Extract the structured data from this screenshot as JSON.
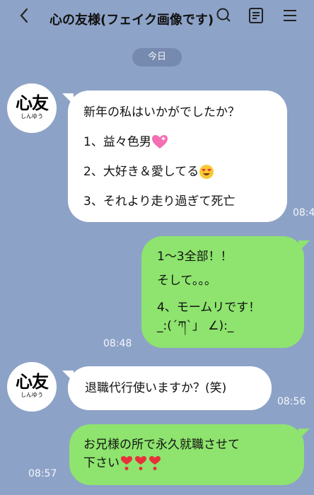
{
  "header": {
    "title": "心の友様(フェイク画像です)",
    "back_icon": "chevron-left-icon",
    "icons": [
      "search-icon",
      "notes-icon",
      "menu-icon"
    ]
  },
  "date_label": "今日",
  "contact": {
    "avatar_big": "心友",
    "avatar_small": "しんゆう"
  },
  "messages": [
    {
      "side": "in",
      "lines": [
        "新年の私はいかがでしたか？",
        "1、益々色男",
        "2、大好き＆愛してる",
        "3、それより走り過ぎて死亡"
      ],
      "time": "08:4"
    },
    {
      "side": "out",
      "lines": [
        "1〜3全部！！",
        "そして。。。",
        "4、モームリです！",
        "_:(´ཀ`」 ∠):_"
      ],
      "time": "08:48"
    },
    {
      "side": "in",
      "lines": [
        "退職代行使いますか？(笑)"
      ],
      "time": "08:56"
    },
    {
      "side": "out",
      "lines": [
        "お兄様の所で永久就職させて",
        "下さい"
      ],
      "time": "08:57"
    }
  ],
  "emoji": {
    "hearts": "sparkling-heart",
    "love_face": "heart-eyes-face",
    "red_hearts": "red-heart-exclamation"
  }
}
